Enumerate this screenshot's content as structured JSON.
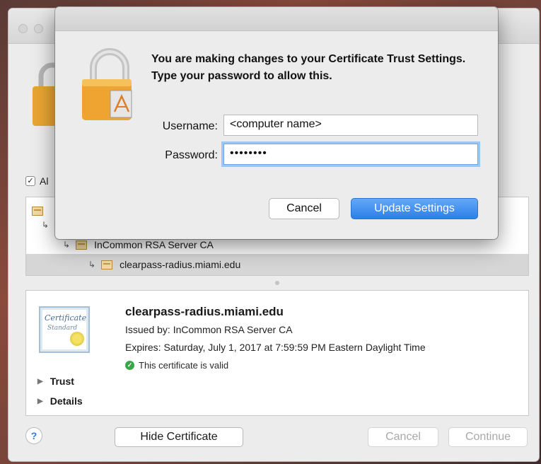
{
  "sheet": {
    "message": "You are making changes to your Certificate Trust Settings. Type your password to allow this.",
    "username_label": "Username:",
    "username_value": "<computer name>",
    "password_label": "Password:",
    "password_value": "••••••••",
    "cancel_label": "Cancel",
    "update_label": "Update Settings",
    "accent_color": "#2c7fe9"
  },
  "background": {
    "always_trust_label": "Al",
    "tree": {
      "items": [
        {
          "label": "InCommon RSA Server CA"
        },
        {
          "label": "clearpass-radius.miami.edu"
        }
      ]
    },
    "certificate": {
      "name": "clearpass-radius.miami.edu",
      "issued_by": "Issued by: InCommon RSA Server CA",
      "expires": "Expires: Saturday, July 1, 2017 at 7:59:59 PM Eastern Daylight Time",
      "status": "This certificate is valid",
      "thumb_text_1": "Certificate",
      "thumb_text_2": "Standard"
    },
    "disclosures": [
      "Trust",
      "Details"
    ],
    "help_label": "?",
    "hide_certificate_label": "Hide Certificate",
    "cancel_label": "Cancel",
    "continue_label": "Continue"
  }
}
